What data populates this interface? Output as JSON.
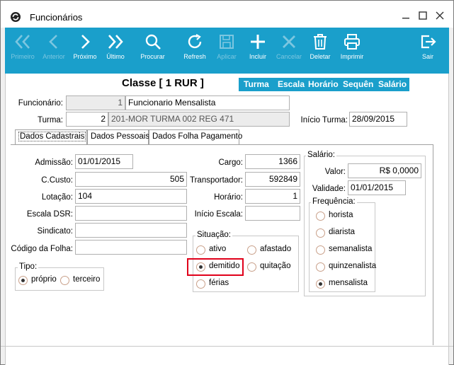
{
  "window": {
    "title": "Funcionários"
  },
  "toolbar": {
    "buttons": [
      {
        "id": "primeiro",
        "label": "Primeiro",
        "icon": "double-chevron-left-icon",
        "enabled": false
      },
      {
        "id": "anterior",
        "label": "Anterior",
        "icon": "chevron-left-icon",
        "enabled": false
      },
      {
        "id": "proximo",
        "label": "Próximo",
        "icon": "chevron-right-icon",
        "enabled": true
      },
      {
        "id": "ultimo",
        "label": "Último",
        "icon": "double-chevron-right-icon",
        "enabled": true
      },
      {
        "id": "procurar",
        "label": "Procurar",
        "icon": "search-icon",
        "enabled": true
      },
      {
        "id": "refresh",
        "label": "Refresh",
        "icon": "refresh-icon",
        "enabled": true
      },
      {
        "id": "aplicar",
        "label": "Aplicar",
        "icon": "save-icon",
        "enabled": false
      },
      {
        "id": "incluir",
        "label": "Incluir",
        "icon": "plus-icon",
        "enabled": true
      },
      {
        "id": "cancelar",
        "label": "Cancelar",
        "icon": "close-icon",
        "enabled": false
      },
      {
        "id": "deletar",
        "label": "Deletar",
        "icon": "trash-icon",
        "enabled": true
      },
      {
        "id": "imprimir",
        "label": "Imprimir",
        "icon": "printer-icon",
        "enabled": true
      },
      {
        "id": "sair",
        "label": "Sair",
        "icon": "exit-icon",
        "enabled": true
      }
    ],
    "color": "#1a9fcb"
  },
  "header": {
    "classe": "Classe [ 1 RUR ]",
    "nav": [
      "Turma",
      "Escala",
      "Horário",
      "Sequên",
      "Salário"
    ]
  },
  "form": {
    "funcionario_label": "Funcionário:",
    "funcionario_id": "1",
    "funcionario_name": "Funcionario Mensalista",
    "turma_label": "Turma:",
    "turma_id": "2",
    "turma_desc": "201-MOR TURMA 002 REG 471",
    "inicio_turma_label": "Início Turma:",
    "inicio_turma": "28/09/2015"
  },
  "tabs": [
    "Dados Cadastrais",
    "Dados Pessoais",
    "Dados Folha Pagamento"
  ],
  "cadastrais": {
    "admissao_label": "Admissão:",
    "admissao": "01/01/2015",
    "ccusto_label": "C.Custo:",
    "ccusto": "505",
    "lotacao_label": "Lotação:",
    "lotacao": "104",
    "escala_dsr_label": "Escala DSR:",
    "escala_dsr": "",
    "sindicato_label": "Sindicato:",
    "sindicato": "",
    "codigo_folha_label": "Código da Folha:",
    "codigo_folha": "",
    "cargo_label": "Cargo:",
    "cargo": "1366",
    "transportador_label": "Transportador:",
    "transportador": "592849",
    "horario_label": "Horário:",
    "horario": "1",
    "inicio_escala_label": "Início Escala:",
    "inicio_escala": ""
  },
  "tipo": {
    "label": "Tipo:",
    "options": [
      "próprio",
      "terceiro"
    ],
    "selected": "próprio"
  },
  "situacao": {
    "label": "Situação:",
    "options": [
      "ativo",
      "afastado",
      "demitido",
      "quitação",
      "férias"
    ],
    "selected": "demitido"
  },
  "salario": {
    "label": "Salário:",
    "valor_label": "Valor:",
    "valor": "R$ 0,0000",
    "validade_label": "Validade:",
    "validade": "01/01/2015"
  },
  "frequencia": {
    "label": "Frequência:",
    "options": [
      "horista",
      "diarista",
      "semanalista",
      "quinzenalista",
      "mensalista"
    ],
    "selected": "mensalista"
  }
}
